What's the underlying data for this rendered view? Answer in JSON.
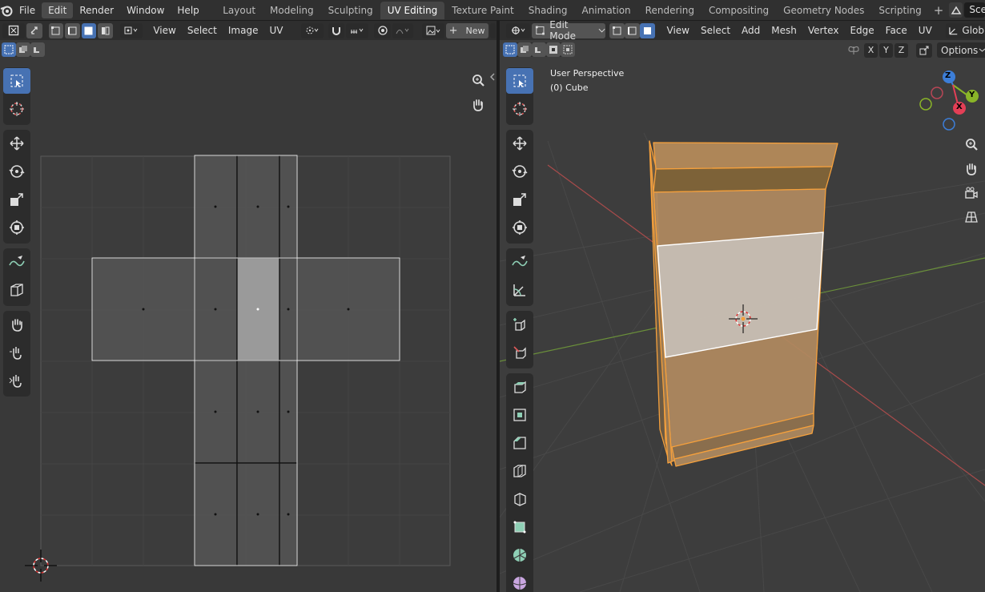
{
  "topbar": {
    "menus": [
      "File",
      "Edit",
      "Render",
      "Window",
      "Help"
    ],
    "active_menu": "Edit",
    "workspaces": [
      "Layout",
      "Modeling",
      "Sculpting",
      "UV Editing",
      "Texture Paint",
      "Shading",
      "Animation",
      "Rendering",
      "Compositing",
      "Geometry Nodes",
      "Scripting"
    ],
    "active_workspace": "UV Editing",
    "add_tab": "+",
    "scene_label": "Scene"
  },
  "uv_editor": {
    "menus": [
      "View",
      "Select",
      "Image",
      "UV"
    ],
    "new_button": "New",
    "new_plus": "+"
  },
  "view3d": {
    "mode": "Edit Mode",
    "menus": [
      "View",
      "Select",
      "Add",
      "Mesh",
      "Vertex",
      "Edge",
      "Face",
      "UV"
    ],
    "transform_orientation": "Glob",
    "overlay_text_1": "User Perspective",
    "overlay_text_2": "(0) Cube",
    "mirror_axes": [
      "X",
      "Y",
      "Z"
    ],
    "options_label": "Options",
    "gizmo": {
      "z": "Z",
      "y": "Y",
      "x": "X"
    }
  },
  "colors": {
    "accent": "#4772b3",
    "selection_orange": "#f5a03c",
    "face_fill": "#b48a5a",
    "header": "#2e2e2e",
    "topbar": "#303030"
  }
}
